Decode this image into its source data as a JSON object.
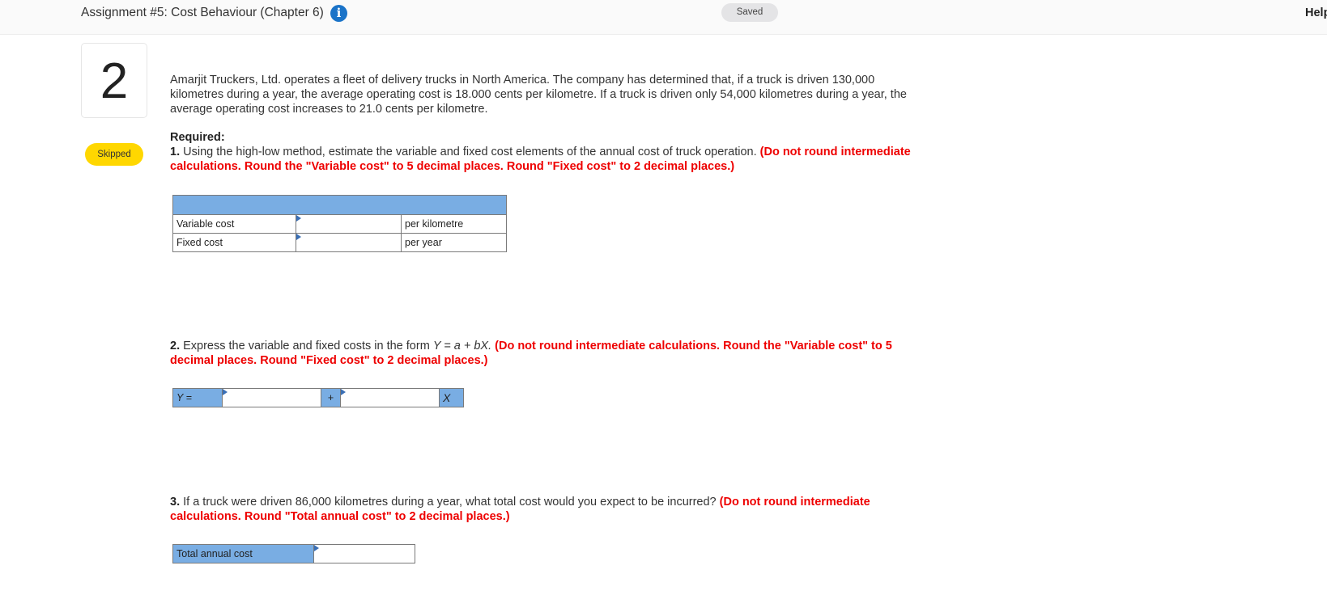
{
  "header": {
    "assignment_title": "Assignment #5: Cost Behaviour (Chapter 6)",
    "info_icon": "info-circle-icon",
    "saved_label": "Saved",
    "help_label": "Help"
  },
  "question": {
    "number": "2",
    "status": "Skipped",
    "intro": "Amarjit Truckers, Ltd. operates a fleet of delivery trucks in North America. The company has determined that, if a truck is driven 130,000 kilometres during a year, the average operating cost is 18.000 cents per kilometre. If a truck is driven only 54,000 kilometres during a year, the average operating cost increases to 21.0 cents per kilometre.",
    "required_label": "Required:",
    "parts": [
      {
        "num": "1.",
        "text": " Using the high-low method, estimate the variable and fixed cost elements of the annual cost of truck operation. ",
        "instruction": "(Do not round intermediate calculations. Round the \"Variable cost\" to 5 decimal places. Round \"Fixed cost\" to 2 decimal places.)"
      },
      {
        "num": "2.",
        "text_pre": " Express the variable and fixed costs in the form ",
        "formula": "Y = a + bX.",
        "instruction": " (Do not round intermediate calculations. Round the \"Variable cost\" to 5 decimal places. Round \"Fixed cost\" to 2 decimal places.)"
      },
      {
        "num": "3.",
        "text": " If a truck were driven 86,000 kilometres during a year, what total cost would you expect to be incurred? ",
        "instruction": "(Do not round intermediate calculations. Round \"Total annual cost\" to 2 decimal places.)"
      }
    ]
  },
  "table1": {
    "rows": [
      {
        "label": "Variable cost",
        "value": "",
        "unit": "per kilometre"
      },
      {
        "label": "Fixed cost",
        "value": "",
        "unit": "per year"
      }
    ]
  },
  "equation": {
    "y_label": "Y =",
    "plus": "+",
    "x_label": "X",
    "a_value": "",
    "b_value": ""
  },
  "table3": {
    "label": "Total annual cost",
    "value": ""
  }
}
